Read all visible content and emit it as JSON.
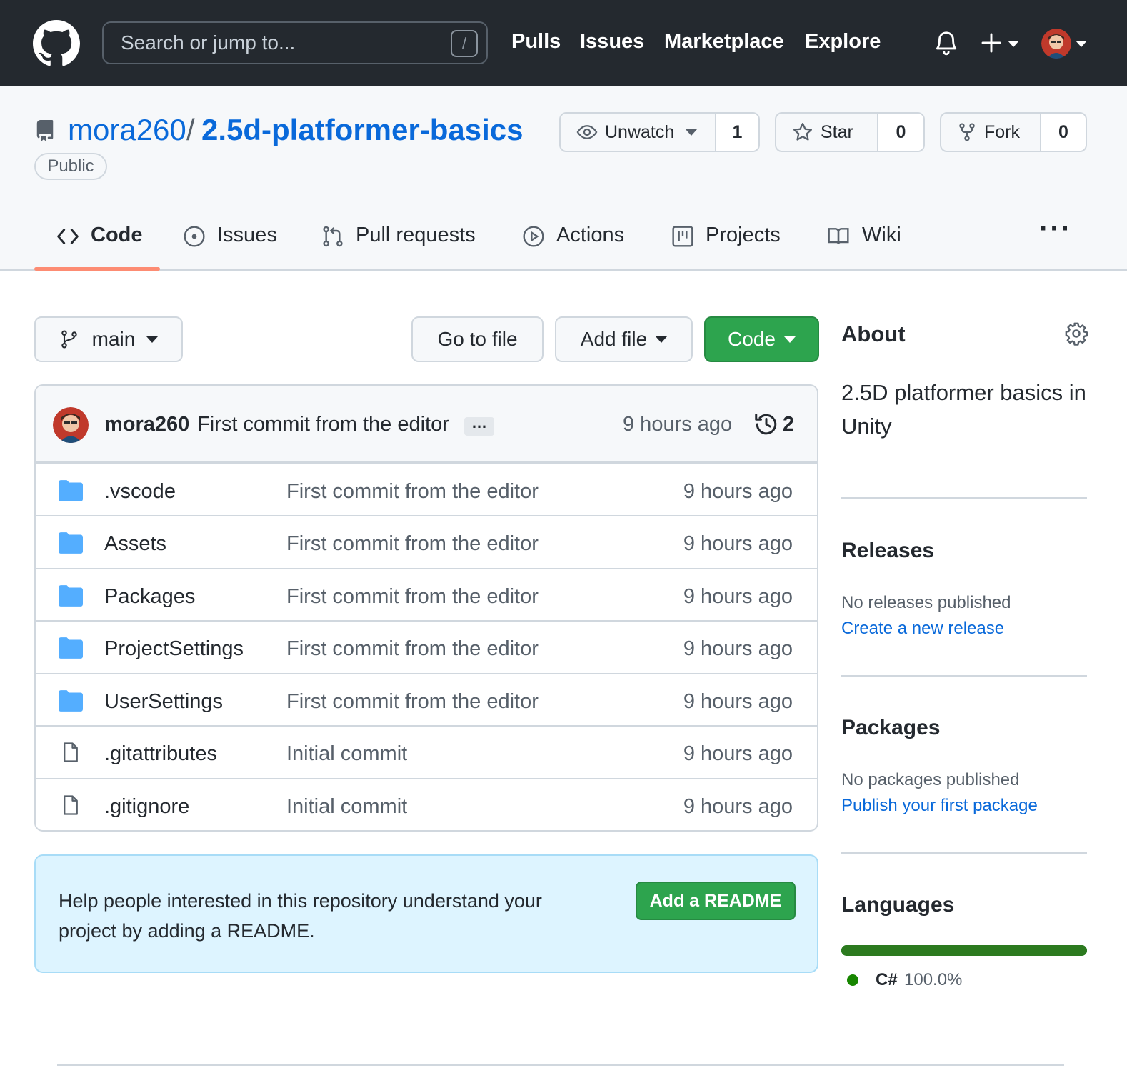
{
  "colors": {
    "header_bg": "#24292f",
    "link": "#0969da",
    "green_button": "#2da44e",
    "tab_underline": "#fd8c73",
    "readme_bg": "#ddf4ff",
    "csharp": "#178600"
  },
  "header": {
    "search_placeholder": "Search or jump to...",
    "search_shortcut": "/",
    "nav": [
      "Pulls",
      "Issues",
      "Marketplace",
      "Explore"
    ],
    "icons": [
      "github-logo-icon",
      "bell-icon",
      "plus-icon",
      "avatar"
    ]
  },
  "repo": {
    "owner": "mora260",
    "separator": "/",
    "name": "2.5d-platformer-basics",
    "visibility": "Public",
    "watch_label": "Unwatch",
    "watch_count": "1",
    "star_label": "Star",
    "star_count": "0",
    "fork_label": "Fork",
    "fork_count": "0"
  },
  "tabs": [
    {
      "label": "Code",
      "icon": "code-icon",
      "active": true
    },
    {
      "label": "Issues",
      "icon": "issue-icon"
    },
    {
      "label": "Pull requests",
      "icon": "pull-request-icon"
    },
    {
      "label": "Actions",
      "icon": "play-icon"
    },
    {
      "label": "Projects",
      "icon": "project-icon"
    },
    {
      "label": "Wiki",
      "icon": "book-icon"
    }
  ],
  "toolbar": {
    "branch": "main",
    "go_to_file": "Go to file",
    "add_file": "Add file",
    "code": "Code"
  },
  "commit": {
    "author": "mora260",
    "message": "First commit from the editor",
    "ellipsis": "…",
    "time": "9 hours ago",
    "count": "2"
  },
  "files": [
    {
      "name": ".vscode",
      "type": "folder",
      "message": "First commit from the editor",
      "time": "9 hours ago"
    },
    {
      "name": "Assets",
      "type": "folder",
      "message": "First commit from the editor",
      "time": "9 hours ago"
    },
    {
      "name": "Packages",
      "type": "folder",
      "message": "First commit from the editor",
      "time": "9 hours ago"
    },
    {
      "name": "ProjectSettings",
      "type": "folder",
      "message": "First commit from the editor",
      "time": "9 hours ago"
    },
    {
      "name": "UserSettings",
      "type": "folder",
      "message": "First commit from the editor",
      "time": "9 hours ago"
    },
    {
      "name": ".gitattributes",
      "type": "file",
      "message": "Initial commit",
      "time": "9 hours ago"
    },
    {
      "name": ".gitignore",
      "type": "file",
      "message": "Initial commit",
      "time": "9 hours ago"
    }
  ],
  "readme_banner": {
    "text": "Help people interested in this repository understand your project by adding a README.",
    "button": "Add a README"
  },
  "sidebar": {
    "about_title": "About",
    "about_description": "2.5D platformer basics in Unity",
    "releases_title": "Releases",
    "releases_empty": "No releases published",
    "releases_link": "Create a new release",
    "packages_title": "Packages",
    "packages_empty": "No packages published",
    "packages_link": "Publish your first package",
    "languages_title": "Languages",
    "languages": [
      {
        "name": "C#",
        "percent": "100.0%",
        "share": 1.0
      }
    ]
  }
}
